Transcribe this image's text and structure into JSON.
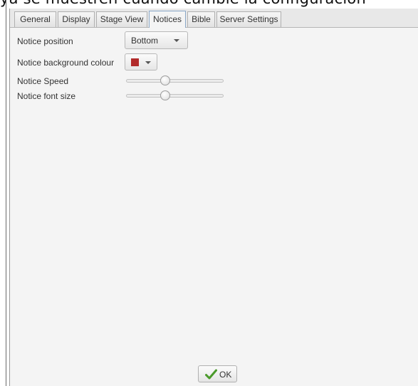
{
  "background": {
    "cropped_text": "ya se muestren cuando cambie la configuración"
  },
  "tabs": [
    {
      "label": "General",
      "active": false
    },
    {
      "label": "Display",
      "active": false
    },
    {
      "label": "Stage View",
      "active": false
    },
    {
      "label": "Notices",
      "active": true
    },
    {
      "label": "Bible",
      "active": false
    },
    {
      "label": "Server Settings",
      "active": false
    }
  ],
  "notices": {
    "position": {
      "label": "Notice position",
      "value": "Bottom"
    },
    "background_colour": {
      "label": "Notice background colour",
      "swatch_color": "#b12a2a"
    },
    "speed": {
      "label": "Notice Speed",
      "value_fraction": 0.4
    },
    "font_size": {
      "label": "Notice font size",
      "value_fraction": 0.4
    }
  },
  "footer": {
    "ok_label": "OK",
    "ok_icon": "check-icon"
  },
  "colors": {
    "window_bg": "#f4f4f4",
    "active_tab_border": "#8aa8c8",
    "check_green": "#4a9a2a"
  }
}
